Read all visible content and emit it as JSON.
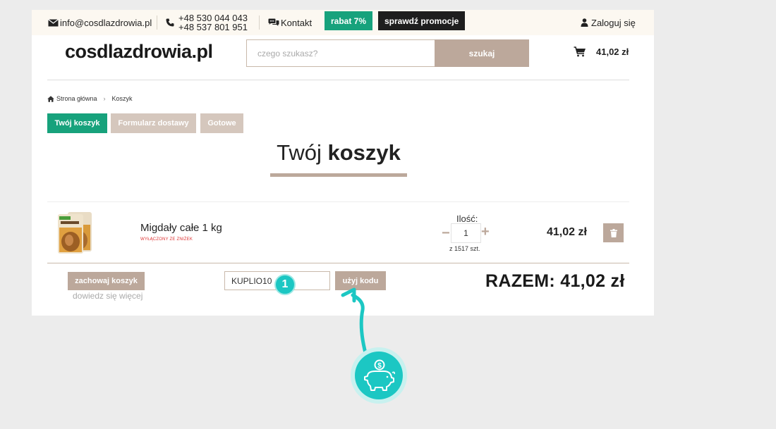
{
  "topbar": {
    "email": "info@cosdlazdrowia.pl",
    "phone_1": "+48 530 044 043",
    "phone_2": "+48 537 801 951",
    "contact": "Kontakt",
    "rabat": "rabat 7%",
    "promo": "sprawdź promocje",
    "login": "Zaloguj się"
  },
  "header": {
    "logo": "cosdlazdrowia.pl",
    "search_placeholder": "czego szukasz?",
    "search_button": "szukaj",
    "cart_total": "41,02 zł"
  },
  "breadcrumb": [
    "Strona główna",
    "Koszyk"
  ],
  "steps": [
    "Twój koszyk",
    "Formularz dostawy",
    "Gotowe"
  ],
  "title": {
    "light": "Twój",
    "bold": "koszyk"
  },
  "item": {
    "name": "Migdały całe 1 kg",
    "note": "WYŁĄCZONY ZE ZNIŻEK",
    "qty_label": "Ilość:",
    "qty_value": "1",
    "stock": "z 1517 szt.",
    "price": "41,02 zł"
  },
  "footer": {
    "keep_button": "zachowaj koszyk",
    "learn_more": "dowiedz się więcej",
    "code_value": "KUPLIO10",
    "code_button": "użyj kodu",
    "total": "RAZEM: 41,02 zł"
  },
  "annotation": {
    "badge": "1"
  },
  "colors": {
    "accent_green": "#17a27c",
    "brand_taupe": "#bca89b",
    "annotation_teal": "#1cc7c3"
  }
}
